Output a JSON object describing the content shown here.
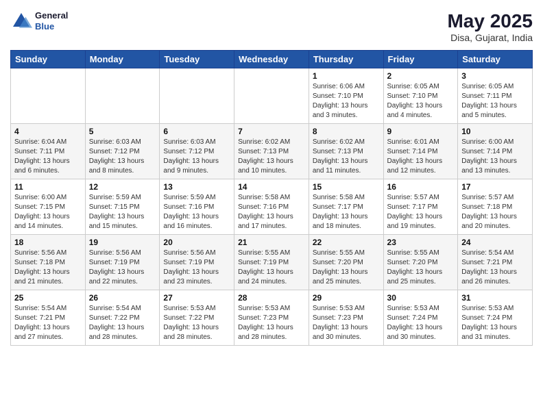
{
  "header": {
    "logo_line1": "General",
    "logo_line2": "Blue",
    "title": "May 2025",
    "subtitle": "Disa, Gujarat, India"
  },
  "weekdays": [
    "Sunday",
    "Monday",
    "Tuesday",
    "Wednesday",
    "Thursday",
    "Friday",
    "Saturday"
  ],
  "weeks": [
    [
      {
        "day": "",
        "info": ""
      },
      {
        "day": "",
        "info": ""
      },
      {
        "day": "",
        "info": ""
      },
      {
        "day": "",
        "info": ""
      },
      {
        "day": "1",
        "info": "Sunrise: 6:06 AM\nSunset: 7:10 PM\nDaylight: 13 hours\nand 3 minutes."
      },
      {
        "day": "2",
        "info": "Sunrise: 6:05 AM\nSunset: 7:10 PM\nDaylight: 13 hours\nand 4 minutes."
      },
      {
        "day": "3",
        "info": "Sunrise: 6:05 AM\nSunset: 7:11 PM\nDaylight: 13 hours\nand 5 minutes."
      }
    ],
    [
      {
        "day": "4",
        "info": "Sunrise: 6:04 AM\nSunset: 7:11 PM\nDaylight: 13 hours\nand 6 minutes."
      },
      {
        "day": "5",
        "info": "Sunrise: 6:03 AM\nSunset: 7:12 PM\nDaylight: 13 hours\nand 8 minutes."
      },
      {
        "day": "6",
        "info": "Sunrise: 6:03 AM\nSunset: 7:12 PM\nDaylight: 13 hours\nand 9 minutes."
      },
      {
        "day": "7",
        "info": "Sunrise: 6:02 AM\nSunset: 7:13 PM\nDaylight: 13 hours\nand 10 minutes."
      },
      {
        "day": "8",
        "info": "Sunrise: 6:02 AM\nSunset: 7:13 PM\nDaylight: 13 hours\nand 11 minutes."
      },
      {
        "day": "9",
        "info": "Sunrise: 6:01 AM\nSunset: 7:14 PM\nDaylight: 13 hours\nand 12 minutes."
      },
      {
        "day": "10",
        "info": "Sunrise: 6:00 AM\nSunset: 7:14 PM\nDaylight: 13 hours\nand 13 minutes."
      }
    ],
    [
      {
        "day": "11",
        "info": "Sunrise: 6:00 AM\nSunset: 7:15 PM\nDaylight: 13 hours\nand 14 minutes."
      },
      {
        "day": "12",
        "info": "Sunrise: 5:59 AM\nSunset: 7:15 PM\nDaylight: 13 hours\nand 15 minutes."
      },
      {
        "day": "13",
        "info": "Sunrise: 5:59 AM\nSunset: 7:16 PM\nDaylight: 13 hours\nand 16 minutes."
      },
      {
        "day": "14",
        "info": "Sunrise: 5:58 AM\nSunset: 7:16 PM\nDaylight: 13 hours\nand 17 minutes."
      },
      {
        "day": "15",
        "info": "Sunrise: 5:58 AM\nSunset: 7:17 PM\nDaylight: 13 hours\nand 18 minutes."
      },
      {
        "day": "16",
        "info": "Sunrise: 5:57 AM\nSunset: 7:17 PM\nDaylight: 13 hours\nand 19 minutes."
      },
      {
        "day": "17",
        "info": "Sunrise: 5:57 AM\nSunset: 7:18 PM\nDaylight: 13 hours\nand 20 minutes."
      }
    ],
    [
      {
        "day": "18",
        "info": "Sunrise: 5:56 AM\nSunset: 7:18 PM\nDaylight: 13 hours\nand 21 minutes."
      },
      {
        "day": "19",
        "info": "Sunrise: 5:56 AM\nSunset: 7:19 PM\nDaylight: 13 hours\nand 22 minutes."
      },
      {
        "day": "20",
        "info": "Sunrise: 5:56 AM\nSunset: 7:19 PM\nDaylight: 13 hours\nand 23 minutes."
      },
      {
        "day": "21",
        "info": "Sunrise: 5:55 AM\nSunset: 7:19 PM\nDaylight: 13 hours\nand 24 minutes."
      },
      {
        "day": "22",
        "info": "Sunrise: 5:55 AM\nSunset: 7:20 PM\nDaylight: 13 hours\nand 25 minutes."
      },
      {
        "day": "23",
        "info": "Sunrise: 5:55 AM\nSunset: 7:20 PM\nDaylight: 13 hours\nand 25 minutes."
      },
      {
        "day": "24",
        "info": "Sunrise: 5:54 AM\nSunset: 7:21 PM\nDaylight: 13 hours\nand 26 minutes."
      }
    ],
    [
      {
        "day": "25",
        "info": "Sunrise: 5:54 AM\nSunset: 7:21 PM\nDaylight: 13 hours\nand 27 minutes."
      },
      {
        "day": "26",
        "info": "Sunrise: 5:54 AM\nSunset: 7:22 PM\nDaylight: 13 hours\nand 28 minutes."
      },
      {
        "day": "27",
        "info": "Sunrise: 5:53 AM\nSunset: 7:22 PM\nDaylight: 13 hours\nand 28 minutes."
      },
      {
        "day": "28",
        "info": "Sunrise: 5:53 AM\nSunset: 7:23 PM\nDaylight: 13 hours\nand 28 minutes."
      },
      {
        "day": "29",
        "info": "Sunrise: 5:53 AM\nSunset: 7:23 PM\nDaylight: 13 hours\nand 30 minutes."
      },
      {
        "day": "30",
        "info": "Sunrise: 5:53 AM\nSunset: 7:24 PM\nDaylight: 13 hours\nand 30 minutes."
      },
      {
        "day": "31",
        "info": "Sunrise: 5:53 AM\nSunset: 7:24 PM\nDaylight: 13 hours\nand 31 minutes."
      }
    ]
  ]
}
